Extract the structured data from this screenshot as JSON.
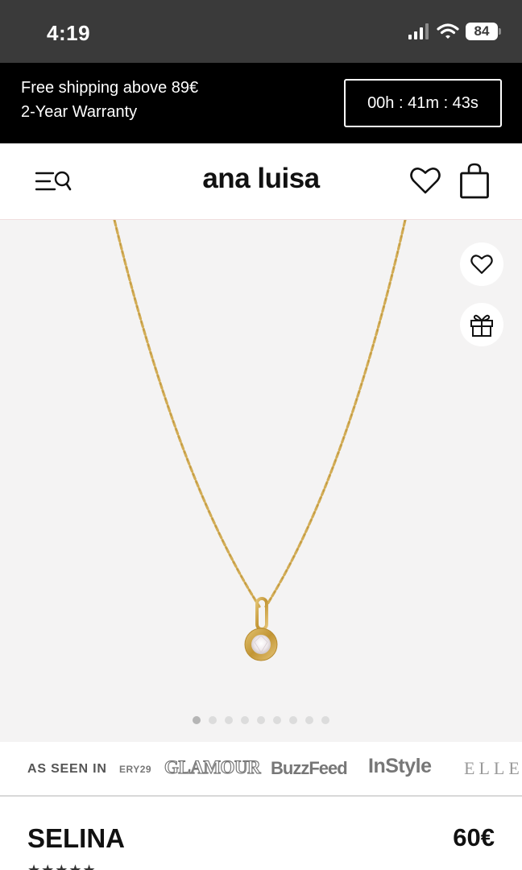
{
  "status_bar": {
    "time": "4:19",
    "battery": "84",
    "icons": [
      "cellular-signal-icon",
      "wifi-icon",
      "battery-icon"
    ]
  },
  "promo": {
    "line1": "Free shipping above 89€",
    "line2": "2-Year Warranty",
    "countdown": "00h : 41m : 43s"
  },
  "header": {
    "logo": "ana luisa",
    "icons": [
      "menu-search-icon",
      "heart-icon",
      "shopping-bag-icon"
    ]
  },
  "gallery": {
    "image": "gold-pendant-necklace",
    "slide_count": 9,
    "active_slide": 1,
    "buttons": [
      "wishlist-heart-icon",
      "gift-icon"
    ]
  },
  "press": {
    "label": "AS SEEN IN",
    "logos": [
      "ERY29",
      "GLAMOUR",
      "BuzzFeed",
      "InStyle",
      "ELLE"
    ]
  },
  "product": {
    "name": "SELINA",
    "price": "60€",
    "rating": 5
  },
  "colors": {
    "status_bar_bg": "#3a3a3a",
    "promo_bg": "#000000",
    "gallery_bg": "#f4f3f3",
    "gold": "#c9a24a"
  }
}
